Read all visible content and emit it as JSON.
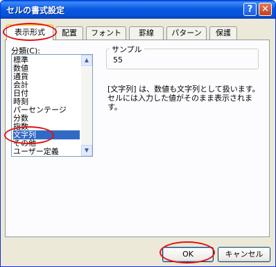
{
  "window": {
    "title": "セルの書式設定"
  },
  "titlebar": {
    "help_glyph": "?",
    "close_glyph": "✕"
  },
  "tabs": [
    {
      "label": "表示形式",
      "active": true
    },
    {
      "label": "配置"
    },
    {
      "label": "フォント"
    },
    {
      "label": "罫線"
    },
    {
      "label": "パターン"
    },
    {
      "label": "保護"
    }
  ],
  "category": {
    "label": "分類(C):",
    "items": [
      "標準",
      "数値",
      "通貨",
      "会計",
      "日付",
      "時刻",
      "パーセンテージ",
      "分数",
      "指数",
      "文字列",
      "その他",
      "ユーザー定義"
    ],
    "selected_index": 9
  },
  "sample": {
    "label": "サンプル",
    "value": "55"
  },
  "description": "[文字列] は、数値も文字列として扱います。セルには入力した値がそのまま表示されます。",
  "buttons": {
    "ok": "OK",
    "cancel": "キャンセル"
  },
  "colors": {
    "selection": "#316ac5",
    "annotation": "#e41010",
    "title_bar": "#0a58e4"
  },
  "icons": {
    "scroll_up": "scroll-up-icon",
    "scroll_down": "scroll-down-icon"
  }
}
